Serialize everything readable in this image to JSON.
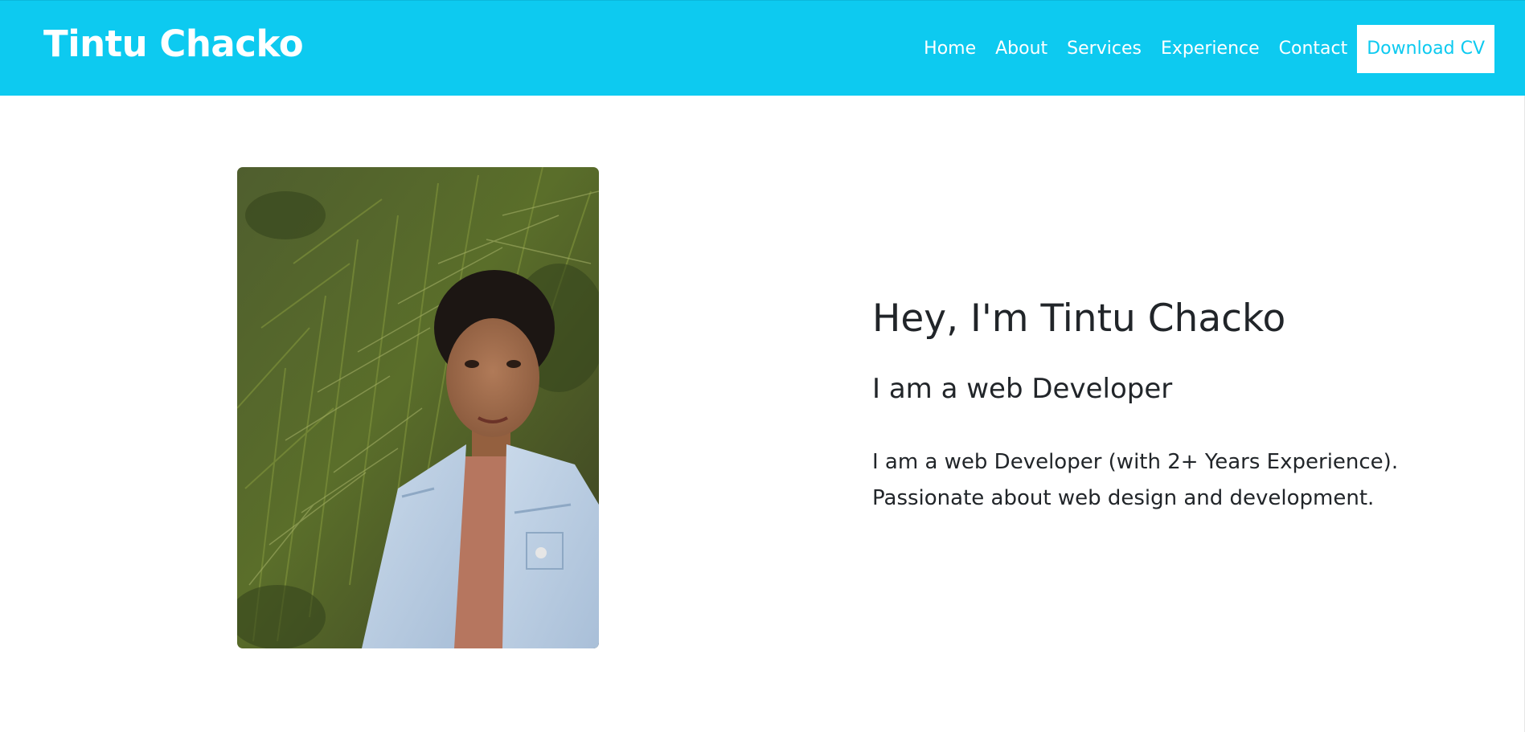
{
  "header": {
    "brand": "Tintu Chacko",
    "nav": [
      {
        "label": "Home"
      },
      {
        "label": "About"
      },
      {
        "label": "Services"
      },
      {
        "label": "Experience"
      },
      {
        "label": "Contact"
      }
    ],
    "download_button": "Download CV"
  },
  "hero": {
    "title": "Hey, I'm Tintu Chacko",
    "subtitle": "I am a web Developer",
    "description_lines": [
      "I am a web Developer (with 2+ Years Experience).",
      "Passionate about web design and development."
    ]
  },
  "colors": {
    "accent": "#0dcaf0",
    "text": "#212529",
    "background": "#ffffff"
  }
}
